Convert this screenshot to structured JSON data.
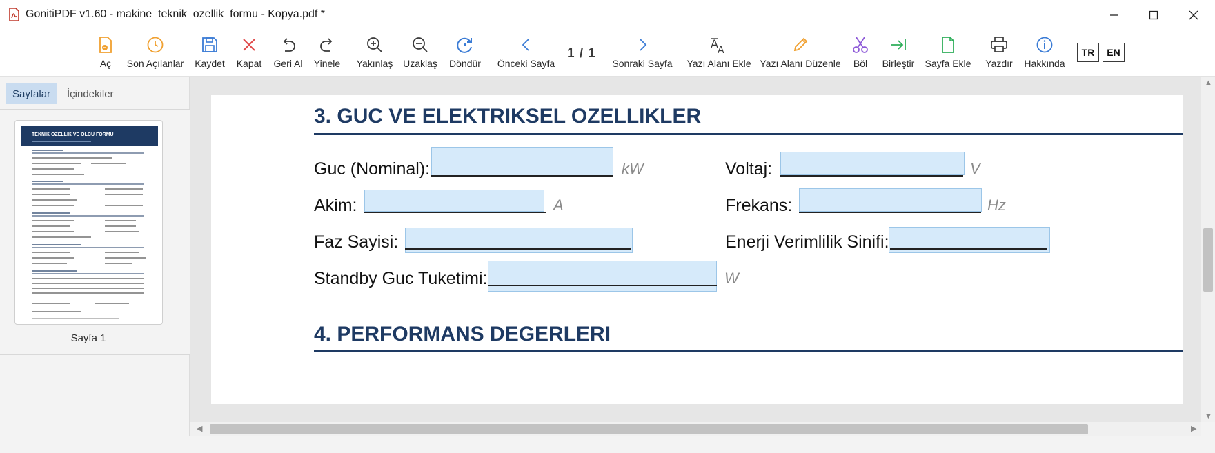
{
  "window": {
    "title": "GonitiPDF v1.60 - makine_teknik_ozellik_formu - Kopya.pdf *"
  },
  "toolbar": {
    "items": [
      {
        "label": "Aç",
        "icon": "open-folder-icon"
      },
      {
        "label": "Son Açılanlar",
        "icon": "clock-icon"
      },
      {
        "label": "Kaydet",
        "icon": "save-icon"
      },
      {
        "label": "Kapat",
        "icon": "close-x-icon"
      },
      {
        "label": "Geri Al",
        "icon": "undo-icon"
      },
      {
        "label": "Yinele",
        "icon": "redo-icon"
      },
      {
        "label": "Yakınlaş",
        "icon": "zoom-in-icon"
      },
      {
        "label": "Uzaklaş",
        "icon": "zoom-out-icon"
      },
      {
        "label": "Döndür",
        "icon": "rotate-icon"
      },
      {
        "label": "Önceki Sayfa",
        "icon": "chevron-left-icon"
      },
      {
        "label": "Sonraki Sayfa",
        "icon": "chevron-right-icon"
      },
      {
        "label": "Yazı Alanı Ekle",
        "icon": "text-field-add-icon"
      },
      {
        "label": "Yazı Alanı Düzenle",
        "icon": "pencil-icon"
      },
      {
        "label": "Böl",
        "icon": "scissors-icon"
      },
      {
        "label": "Birleştir",
        "icon": "merge-icon"
      },
      {
        "label": "Sayfa Ekle",
        "icon": "page-add-icon"
      },
      {
        "label": "Yazdır",
        "icon": "printer-icon"
      },
      {
        "label": "Hakkında",
        "icon": "info-icon"
      }
    ],
    "pager": "1 / 1",
    "lang_tr": "TR",
    "lang_en": "EN"
  },
  "sidebar": {
    "tabs": [
      "Sayfalar",
      "İçindekiler"
    ],
    "active_tab": "Sayfalar",
    "thumbnail_label": "Sayfa 1",
    "thumbnail_title": "TEKNIK OZELLIK VE OLCU FORMU"
  },
  "document": {
    "section3_title": "3. GUC VE ELEKTRIKSEL OZELLIKLER",
    "section4_title": "4. PERFORMANS DEGERLERI",
    "fields": {
      "guc_label": "Guc (Nominal):",
      "guc_unit": "kW",
      "voltaj_label": "Voltaj:",
      "voltaj_unit": "V",
      "akim_label": "Akim:",
      "akim_unit": "A",
      "frekans_label": "Frekans:",
      "frekans_unit": "Hz",
      "faz_label": "Faz Sayisi:",
      "enerji_label": "Enerji Verimlilik Sinifi:",
      "standby_label": "Standby Guc Tuketimi:",
      "standby_unit": "W"
    }
  },
  "colors": {
    "accent_orange": "#f0a030",
    "accent_blue": "#3a7bd5",
    "accent_red": "#e04848",
    "heading_navy": "#1e3a63",
    "field_fill": "#d6eafa"
  }
}
